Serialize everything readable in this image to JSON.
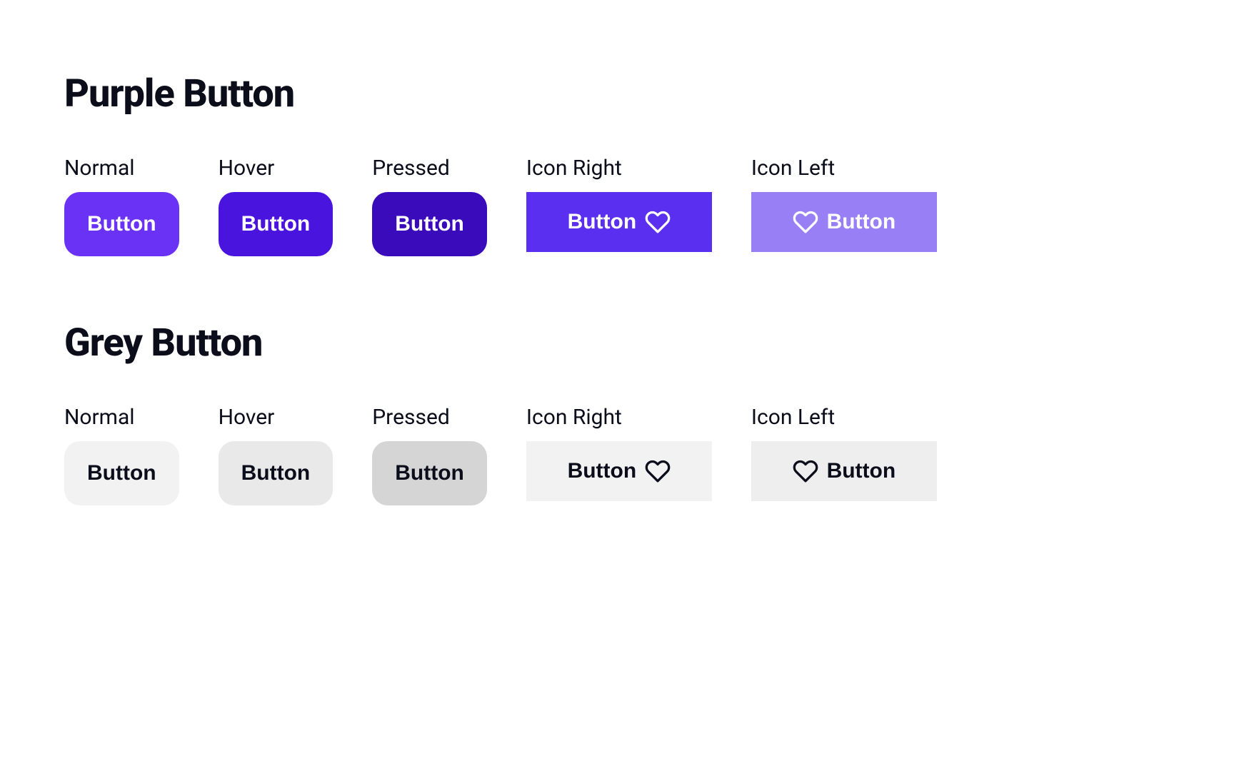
{
  "sections": {
    "purple": {
      "title": "Purple Button",
      "states": {
        "normal": {
          "label": "Normal",
          "button_text": "Button"
        },
        "hover": {
          "label": "Hover",
          "button_text": "Button"
        },
        "pressed": {
          "label": "Pressed",
          "button_text": "Button"
        },
        "icon_right": {
          "label": "Icon Right",
          "button_text": "Button"
        },
        "icon_left": {
          "label": "Icon Left",
          "button_text": "Button"
        }
      }
    },
    "grey": {
      "title": "Grey Button",
      "states": {
        "normal": {
          "label": "Normal",
          "button_text": "Button"
        },
        "hover": {
          "label": "Hover",
          "button_text": "Button"
        },
        "pressed": {
          "label": "Pressed",
          "button_text": "Button"
        },
        "icon_right": {
          "label": "Icon Right",
          "button_text": "Button"
        },
        "icon_left": {
          "label": "Icon Left",
          "button_text": "Button"
        }
      }
    }
  },
  "colors": {
    "purple_normal": "#6A32F4",
    "purple_hover": "#4A14DF",
    "purple_pressed": "#3A0BBB",
    "purple_icon_right": "#5B2FEF",
    "purple_icon_left": "#997FF5",
    "grey_normal": "#F2F2F2",
    "grey_hover": "#E9E9E9",
    "grey_pressed": "#D5D5D5",
    "text_dark": "#0B0E1A",
    "text_light": "#FFFFFF"
  },
  "icons": {
    "heart": "heart-icon"
  }
}
